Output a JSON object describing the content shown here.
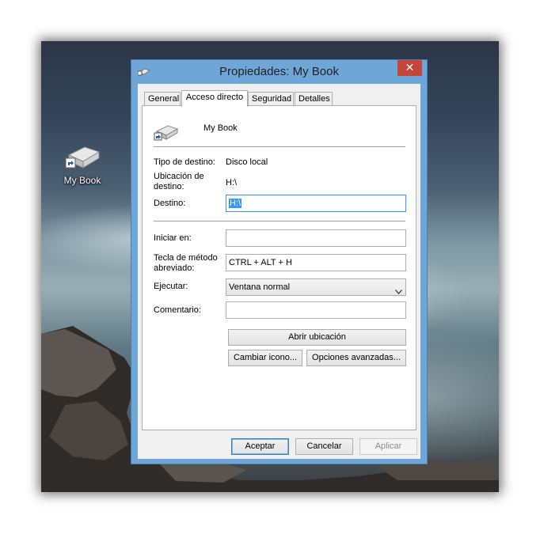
{
  "desktop": {
    "icon_label": "My Book"
  },
  "window": {
    "title": "Propiedades: My Book",
    "close_glyph": "✕",
    "tabs": [
      {
        "label": "General"
      },
      {
        "label": "Acceso directo"
      },
      {
        "label": "Seguridad"
      },
      {
        "label": "Detalles"
      }
    ],
    "active_tab": "Acceso directo"
  },
  "shortcut": {
    "name": "My Book",
    "target_type_label": "Tipo de destino:",
    "target_type_value": "Disco local",
    "target_location_label_1": "Ubicación de",
    "target_location_label_2": "destino:",
    "target_location_value": "H:\\",
    "target_label": "Destino:",
    "target_value": "H:\\",
    "start_in_label": "Iniciar en:",
    "start_in_value": "",
    "hotkey_label_1": "Tecla de método",
    "hotkey_label_2": "abreviado:",
    "hotkey_value": "CTRL + ALT + H",
    "run_label": "Ejecutar:",
    "run_value": "Ventana normal",
    "comment_label": "Comentario:",
    "comment_value": "",
    "open_location_button": "Abrir ubicación",
    "change_icon_button": "Cambiar icono...",
    "advanced_button": "Opciones avanzadas..."
  },
  "footer": {
    "ok_button": "Aceptar",
    "cancel_button": "Cancelar",
    "apply_button": "Aplicar"
  },
  "colors": {
    "titlebar": "#6fa6d8",
    "close": "#c7443a",
    "selection": "#3399ff",
    "default_button_border": "#3c7fb1"
  }
}
